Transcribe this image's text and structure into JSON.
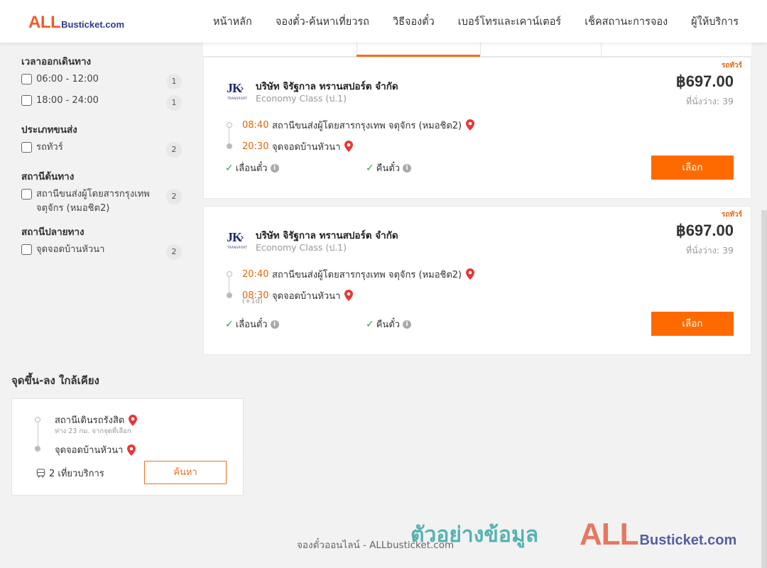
{
  "header": {
    "logo_all": "ALL",
    "logo_rest": "Busticket.com",
    "nav": [
      "หน้าหลัก",
      "จองตั๋ว-ค้นหาเที่ยวรถ",
      "วิธีจองตั๋ว",
      "เบอร์โทรและเคาน์เตอร์",
      "เช็คสถานะการจอง",
      "ผู้ให้บริการ"
    ]
  },
  "filters": {
    "departure_time": {
      "title": "เวลาออกเดินทาง",
      "options": [
        {
          "label": "06:00 - 12:00",
          "count": "1"
        },
        {
          "label": "18:00 - 24:00",
          "count": "1"
        }
      ]
    },
    "transport_type": {
      "title": "ประเภทขนส่ง",
      "options": [
        {
          "label": "รถทัวร์",
          "count": "2"
        }
      ]
    },
    "origin": {
      "title": "สถานีต้นทาง",
      "options": [
        {
          "label": "สถานีขนส่งผู้โดยสารกรุงเทพ จตุจักร (หมอชิต2)",
          "count": "2"
        }
      ]
    },
    "destination": {
      "title": "สถานีปลายทาง",
      "options": [
        {
          "label": "จุดจอดบ้านหัวนา",
          "count": "2"
        }
      ]
    }
  },
  "trips": [
    {
      "bus_type": "รถทัวร์",
      "operator": "บริษัท จิรัฐกาล ทรานสปอร์ต จำกัด",
      "operator_logo": "JK",
      "operator_logo_sub": "TRANSPORT",
      "class": "Economy Class (ป.1)",
      "price": "฿697.00",
      "seats": "ที่นั่งว่าง: 39",
      "depart_time": "08:40",
      "depart_place": "สถานีขนส่งผู้โดยสารกรุงเทพ จตุจักร (หมอชิต2)",
      "arrive_time": "20:30",
      "arrive_place": "จุดจอดบ้านหัวนา",
      "plus_day": "",
      "feature1": "เลื่อนตั๋ว",
      "feature2": "คืนตั๋ว",
      "select_label": "เลือก"
    },
    {
      "bus_type": "รถทัวร์",
      "operator": "บริษัท จิรัฐกาล ทรานสปอร์ต จำกัด",
      "operator_logo": "JK",
      "operator_logo_sub": "TRANSPORT",
      "class": "Economy Class (ป.1)",
      "price": "฿697.00",
      "seats": "ที่นั่งว่าง: 39",
      "depart_time": "20:40",
      "depart_place": "สถานีขนส่งผู้โดยสารกรุงเทพ จตุจักร (หมอชิต2)",
      "arrive_time": "08:30",
      "arrive_place": "จุดจอดบ้านหัวนา",
      "plus_day": "(+1d)",
      "feature1": "เลื่อนตั๋ว",
      "feature2": "คืนตั๋ว",
      "select_label": "เลือก"
    }
  ],
  "nearby": {
    "title": "จุดขึ้น-ลง ใกล้เคียง",
    "from": "สถานีเดินรถรังสิต",
    "distance": "ห่าง 23 กม. จากจุดที่เลือก",
    "to": "จุดจอดบ้านหัวนา",
    "trips": "2 เที่ยวบริการ",
    "search_label": "ค้นหา"
  },
  "footer": {
    "text": "จองตั๋วออนไลน์ - ALLbusticket.com",
    "watermark_text": "ตัวอย่างข้อมูล",
    "watermark_all": "ALL",
    "watermark_rest": "Busticket.com"
  },
  "colors": {
    "accent": "#ff6a00",
    "time": "#e8630a",
    "pin": "#e53935",
    "check": "#2da44e"
  }
}
